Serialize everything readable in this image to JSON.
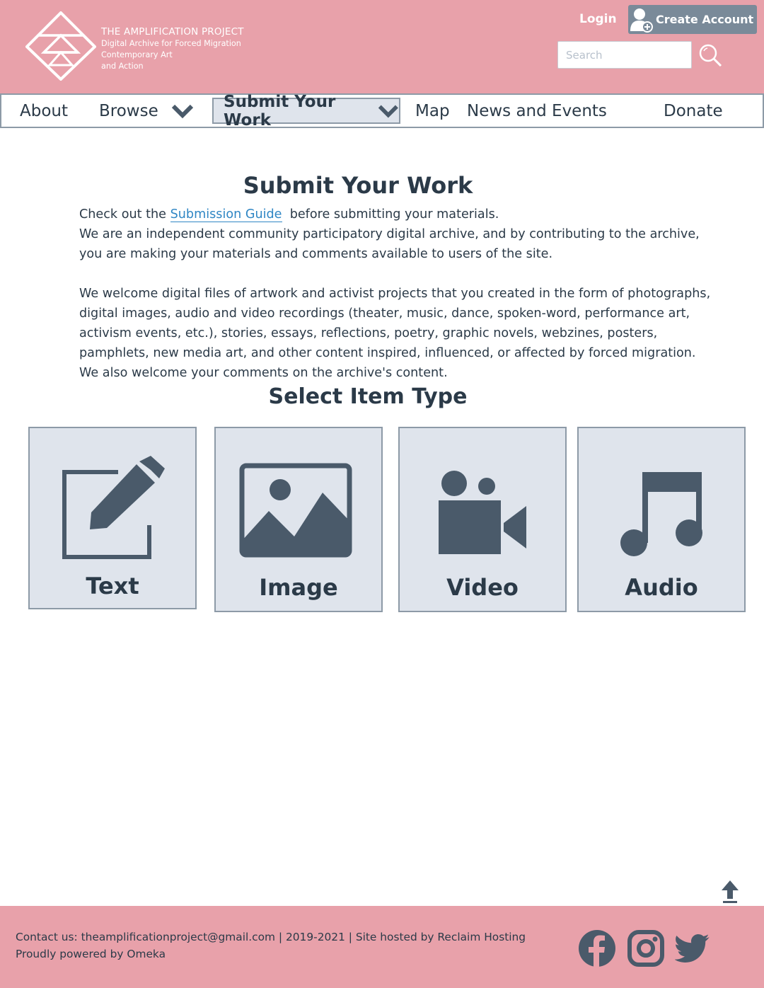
{
  "header": {
    "brand_line1": "THE AMPLIFICATION PROJECT",
    "brand_line2": "Digital Archive for Forced Migration",
    "brand_line3": "Contemporary Art",
    "brand_line4": "and Action",
    "login_label": "Login",
    "create_account_label": "Create Account",
    "search_placeholder": "Search"
  },
  "nav": {
    "items": [
      {
        "label": "About"
      },
      {
        "label": "Browse"
      },
      {
        "label": "Submit Your Work"
      },
      {
        "label": "Map"
      },
      {
        "label": "News and Events"
      },
      {
        "label": "Donate"
      }
    ]
  },
  "main": {
    "title": "Submit Your Work",
    "intro_prefix": "Check out the ",
    "guide_link": "Submission Guide",
    "intro_suffix": "before submitting your materials.",
    "intro_line2": "We are an independent community participatory digital archive, and by contributing to the archive, you are making your materials and comments available to users of the site.",
    "welcome_text": "We welcome digital files of artwork and activist projects that you created in the form of photographs, digital images, audio and video recordings (theater, music, dance, spoken-word, performance art, activism events, etc.), stories, essays, reflections, poetry, graphic novels, webzines, posters, pamphlets, new media art, and other content inspired, influenced, or affected by forced migration. We also welcome your comments on the archive's content.",
    "select_heading": "Select Item Type",
    "item_types": [
      {
        "label": "Text",
        "icon": "edit-icon"
      },
      {
        "label": "Image",
        "icon": "image-icon"
      },
      {
        "label": "Video",
        "icon": "video-camera-icon"
      },
      {
        "label": "Audio",
        "icon": "music-note-icon"
      }
    ]
  },
  "footer": {
    "line1": "Contact us: theamplificationproject@gmail.com | 2019-2021 | Site hosted by Reclaim Hosting",
    "line2": "Proudly powered by Omeka"
  },
  "colors": {
    "header_bg": "#e8a1aa",
    "text_dark": "#2b3a48",
    "icon_slate": "#4a5a6a",
    "card_bg": "#dfe4ec",
    "link_blue": "#2f86c4",
    "button_gray": "#7a8a99"
  }
}
